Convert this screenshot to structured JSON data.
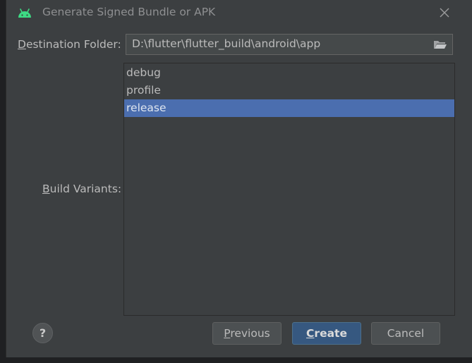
{
  "dialog": {
    "title": "Generate Signed Bundle or APK",
    "icon": "android-icon",
    "accent": "#3ddc84"
  },
  "destination": {
    "label_mnemonic": "D",
    "label_rest": "estination Folder:",
    "value": "D:\\flutter\\flutter_build\\android\\app"
  },
  "build_variants": {
    "label_mnemonic": "B",
    "label_rest": "uild Variants:",
    "items": [
      "debug",
      "profile",
      "release"
    ],
    "selected": "release",
    "selection_color": "#4b6eaf"
  },
  "buttons": {
    "help": "?",
    "previous_mnemonic": "P",
    "previous_rest": "revious",
    "create_mnemonic": "C",
    "create_rest": "reate",
    "cancel": "Cancel"
  }
}
